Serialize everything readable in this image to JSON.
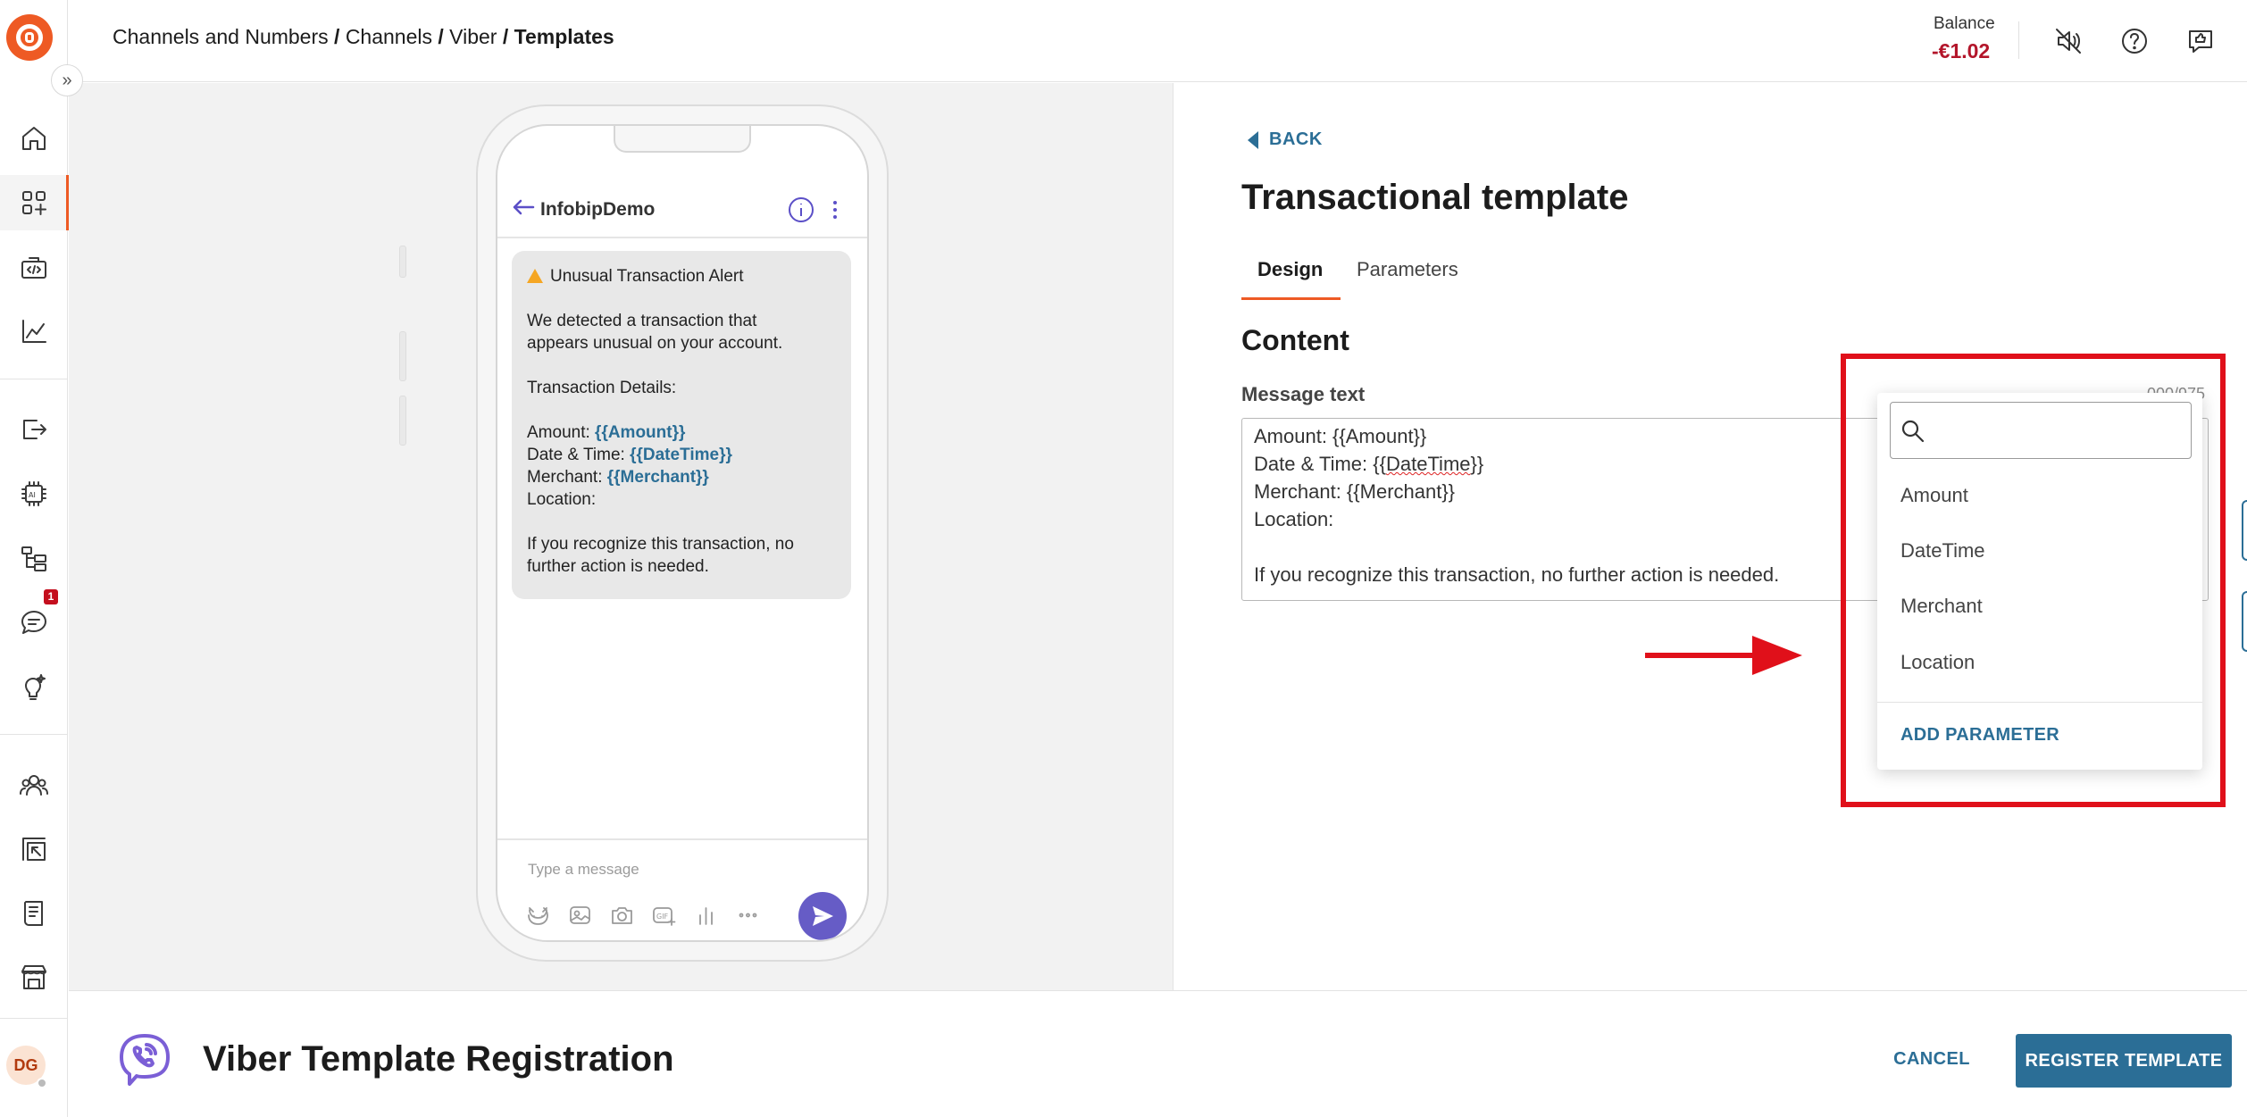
{
  "breadcrumb": {
    "items": [
      "Channels and Numbers",
      "Channels",
      "Viber"
    ],
    "separator": " / ",
    "current": "Templates"
  },
  "balance": {
    "label": "Balance",
    "value": "-€1.02",
    "value_color": "#b3152a"
  },
  "topbar_icons": [
    "sound-off-icon",
    "help-icon",
    "feedback-icon"
  ],
  "rail": {
    "icons": [
      "home-icon",
      "apps-icon",
      "developer-tools-icon",
      "analytics-icon",
      "exports-icon",
      "ai-chip-icon",
      "flows-icon",
      "conversations-icon",
      "ideas-icon",
      "people-icon",
      "moments-icon",
      "docs-icon",
      "marketplace-icon"
    ],
    "active": "apps-icon",
    "conversations_badge": "1",
    "avatar_initials": "DG"
  },
  "preview": {
    "sender_name": "InfobipDemo",
    "message": {
      "heading": "Unusual Transaction Alert",
      "body_line1": "We detected a transaction that",
      "body_line2": "appears unusual on your account.",
      "details_label": "Transaction Details:",
      "amount_label": "Amount: ",
      "amount_param": "{{Amount}}",
      "datetime_label": "Date & Time: ",
      "datetime_param": "{{DateTime}}",
      "merchant_label": "Merchant: ",
      "merchant_param": "{{Merchant}}",
      "location_label": "Location:",
      "footer_line1": "If you recognize this transaction, no",
      "footer_line2": "further action is needed."
    },
    "input_placeholder": "Type a message",
    "tool_icons": [
      "sticker-icon",
      "image-icon",
      "camera-icon",
      "gif-icon",
      "poll-icon",
      "more-icon"
    ],
    "accent_color": "#665cc6"
  },
  "panel": {
    "back_label": "BACK",
    "title": "Transactional template",
    "tabs": [
      {
        "label": "Design",
        "active": true
      },
      {
        "label": "Parameters",
        "active": false
      }
    ],
    "content_heading": "Content",
    "message_text_label": "Message text",
    "counter": "000/975",
    "textarea_lines": [
      "Amount: {{Amount}}",
      "Date & Time: {{DateTime}}",
      "Merchant: {{Merchant}}",
      "Location:",
      "",
      "If you recognize this transaction, no further action is needed."
    ]
  },
  "parameter_dropdown": {
    "search_value": "",
    "items": [
      "Amount",
      "DateTime",
      "Merchant",
      "Location"
    ],
    "add_label": "ADD PARAMETER",
    "highlight_color": "#e0101a"
  },
  "footer": {
    "title": "Viber Template Registration",
    "cancel_label": "CANCEL",
    "register_label": "REGISTER TEMPLATE",
    "primary_color": "#2b6e96"
  }
}
